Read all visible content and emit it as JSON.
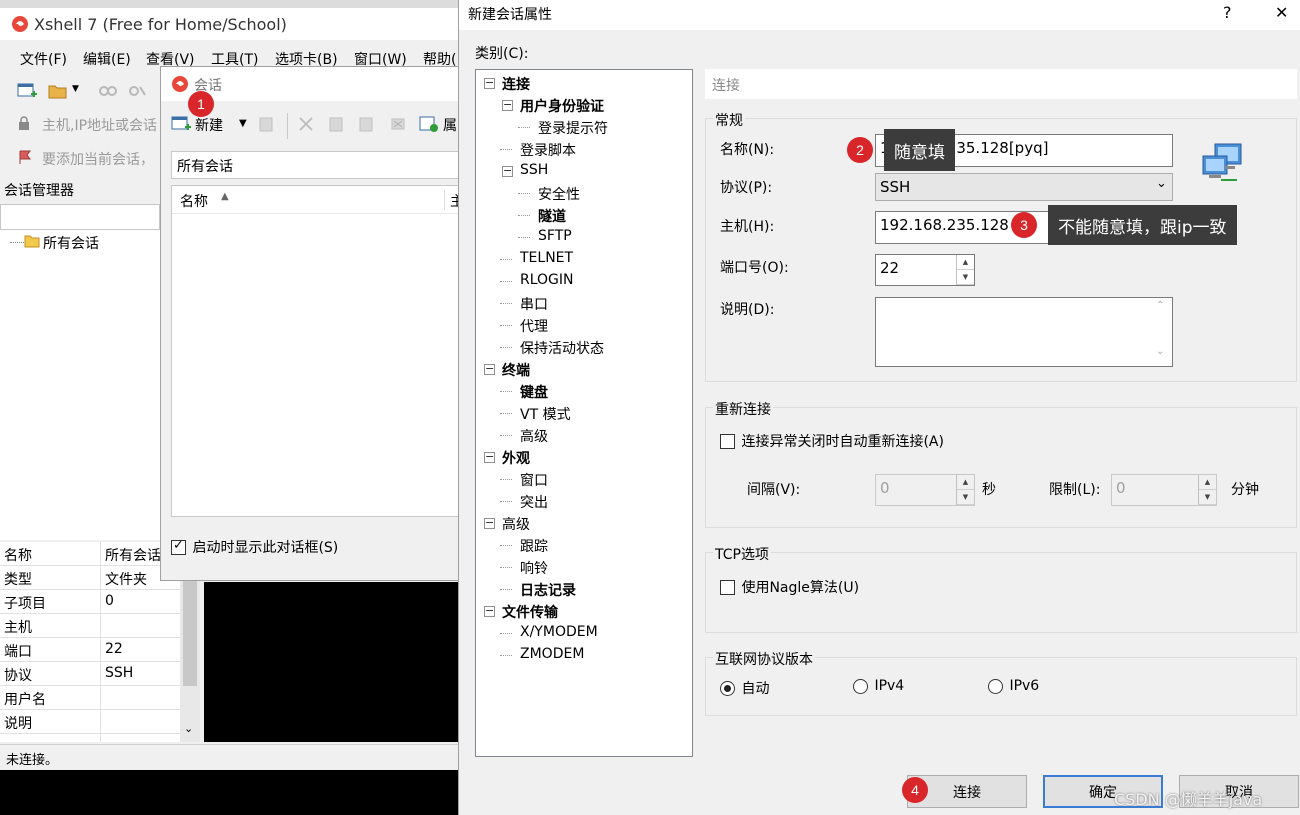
{
  "main_window": {
    "title": "Xshell 7 (Free for Home/School)",
    "menu": [
      "文件(F)",
      "编辑(E)",
      "查看(V)",
      "工具(T)",
      "选项卡(B)",
      "窗口(W)",
      "帮助("
    ],
    "address_placeholder": "主机,IP地址或会话",
    "add_session_hint": "要添加当前会话，",
    "session_manager_title": "会话管理器",
    "tree_all_sessions": "所有会话",
    "properties": [
      {
        "key": "名称",
        "value": "所有会话"
      },
      {
        "key": "类型",
        "value": "文件夹"
      },
      {
        "key": "子项目",
        "value": "0"
      },
      {
        "key": "主机",
        "value": ""
      },
      {
        "key": "端口",
        "value": "22"
      },
      {
        "key": "协议",
        "value": "SSH"
      },
      {
        "key": "用户名",
        "value": ""
      },
      {
        "key": "说明",
        "value": ""
      }
    ],
    "status": "未连接。"
  },
  "session_dialog": {
    "title": "会话",
    "new_label": "新建",
    "props_label": "属",
    "breadcrumb": "所有会话",
    "col_name": "名称",
    "col_host": "主",
    "startup_checkbox": "启动时显示此对话框(S)",
    "startup_checked": true
  },
  "prop_dialog": {
    "title": "新建会话属性",
    "help_glyph": "?",
    "close_glyph": "✕",
    "category_label": "类别(C):",
    "tree": [
      {
        "label": "连接",
        "bold": true,
        "level": 0,
        "expand": true
      },
      {
        "label": "用户身份验证",
        "bold": true,
        "level": 1,
        "expand": true
      },
      {
        "label": "登录提示符",
        "bold": false,
        "level": 2
      },
      {
        "label": "登录脚本",
        "bold": false,
        "level": 1
      },
      {
        "label": "SSH",
        "bold": false,
        "level": 1,
        "expand": true
      },
      {
        "label": "安全性",
        "bold": false,
        "level": 2
      },
      {
        "label": "隧道",
        "bold": true,
        "level": 2
      },
      {
        "label": "SFTP",
        "bold": false,
        "level": 2
      },
      {
        "label": "TELNET",
        "bold": false,
        "level": 1
      },
      {
        "label": "RLOGIN",
        "bold": false,
        "level": 1
      },
      {
        "label": "串口",
        "bold": false,
        "level": 1
      },
      {
        "label": "代理",
        "bold": false,
        "level": 1
      },
      {
        "label": "保持活动状态",
        "bold": false,
        "level": 1
      },
      {
        "label": "终端",
        "bold": true,
        "level": 0,
        "expand": true
      },
      {
        "label": "键盘",
        "bold": true,
        "level": 1
      },
      {
        "label": "VT 模式",
        "bold": false,
        "level": 1
      },
      {
        "label": "高级",
        "bold": false,
        "level": 1
      },
      {
        "label": "外观",
        "bold": true,
        "level": 0,
        "expand": true
      },
      {
        "label": "窗口",
        "bold": false,
        "level": 1
      },
      {
        "label": "突出",
        "bold": false,
        "level": 1
      },
      {
        "label": "高级",
        "bold": false,
        "level": 0,
        "expand": true
      },
      {
        "label": "跟踪",
        "bold": false,
        "level": 1
      },
      {
        "label": "响铃",
        "bold": false,
        "level": 1
      },
      {
        "label": "日志记录",
        "bold": true,
        "level": 1
      },
      {
        "label": "文件传输",
        "bold": true,
        "level": 0,
        "expand": true
      },
      {
        "label": "X/YMODEM",
        "bold": false,
        "level": 1
      },
      {
        "label": "ZMODEM",
        "bold": false,
        "level": 1
      }
    ],
    "panel_header": "连接",
    "general": {
      "title": "常规",
      "name_label": "名称(N):",
      "name_value": "192.168.235.128[pyq]",
      "protocol_label": "协议(P):",
      "protocol_value": "SSH",
      "host_label": "主机(H):",
      "host_value": "192.168.235.128",
      "port_label": "端口号(O):",
      "port_value": "22",
      "desc_label": "说明(D):"
    },
    "reconnect": {
      "title": "重新连接",
      "checkbox": "连接异常关闭时自动重新连接(A)",
      "interval_label": "间隔(V):",
      "interval_value": "0",
      "interval_unit": "秒",
      "limit_label": "限制(L):",
      "limit_value": "0",
      "limit_unit": "分钟"
    },
    "tcp": {
      "title": "TCP选项",
      "checkbox": "使用Nagle算法(U)"
    },
    "ip_version": {
      "title": "互联网协议版本",
      "options": [
        "自动",
        "IPv4",
        "IPv6"
      ],
      "selected": "自动"
    },
    "buttons": {
      "connect": "连接",
      "ok": "确定",
      "cancel": "取消"
    }
  },
  "annotations": {
    "b1": "1",
    "b2": "2",
    "b3": "3",
    "b4": "4",
    "tip_name": "随意填",
    "tip_host": "不能随意填，跟ip一致",
    "watermark": "CSDN @懒羊羊java"
  }
}
